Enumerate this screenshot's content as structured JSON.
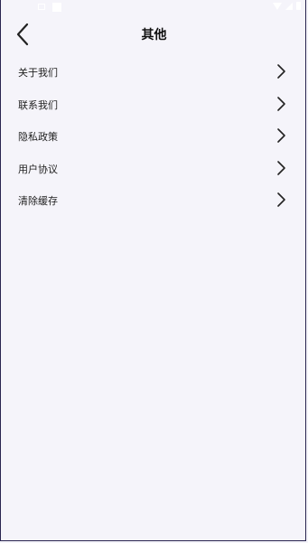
{
  "header": {
    "title": "其他",
    "back_icon": "chevron-left-icon"
  },
  "menu": {
    "items": [
      {
        "label": "关于我们",
        "icon": "chevron-right-icon"
      },
      {
        "label": "联系我们",
        "icon": "chevron-right-icon"
      },
      {
        "label": "隐私政策",
        "icon": "chevron-right-icon"
      },
      {
        "label": "用户协议",
        "icon": "chevron-right-icon"
      },
      {
        "label": "清除缓存",
        "icon": "chevron-right-icon"
      }
    ]
  },
  "colors": {
    "background": "#f5f4fa",
    "frame_border": "#2a2550",
    "text": "#222222"
  }
}
